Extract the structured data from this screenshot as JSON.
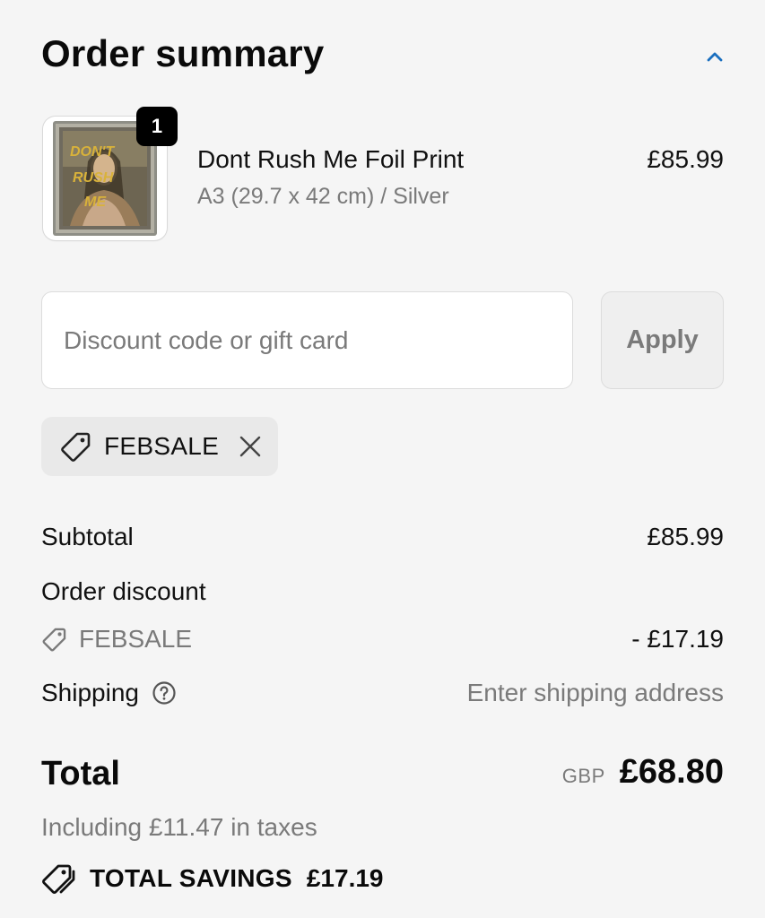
{
  "header": {
    "title": "Order summary",
    "collapse_icon": "chevron-up-icon",
    "accent_color": "#1a6fbf"
  },
  "product": {
    "quantity_badge": "1",
    "name": "Dont Rush Me Foil Print",
    "variant": "A3 (29.7 x 42 cm) / Silver",
    "price": "£85.99",
    "thumbnail_text": [
      "DON'T",
      "RUSH",
      "ME"
    ]
  },
  "discount": {
    "placeholder": "Discount code or gift card",
    "value": "",
    "apply_label": "Apply",
    "applied_code": "FEBSALE",
    "tag_icon": "tag-icon",
    "remove_icon": "close-icon"
  },
  "summary": {
    "subtotal_label": "Subtotal",
    "subtotal_value": "£85.99",
    "order_discount_label": "Order discount",
    "order_discount_code": "FEBSALE",
    "order_discount_value": "- £17.19",
    "shipping_label": "Shipping",
    "shipping_value": "Enter shipping address",
    "total_label": "Total",
    "currency": "GBP",
    "total_value": "£68.80",
    "tax_note": "Including £11.47 in taxes",
    "savings_label": "TOTAL SAVINGS",
    "savings_value": "£17.19"
  }
}
